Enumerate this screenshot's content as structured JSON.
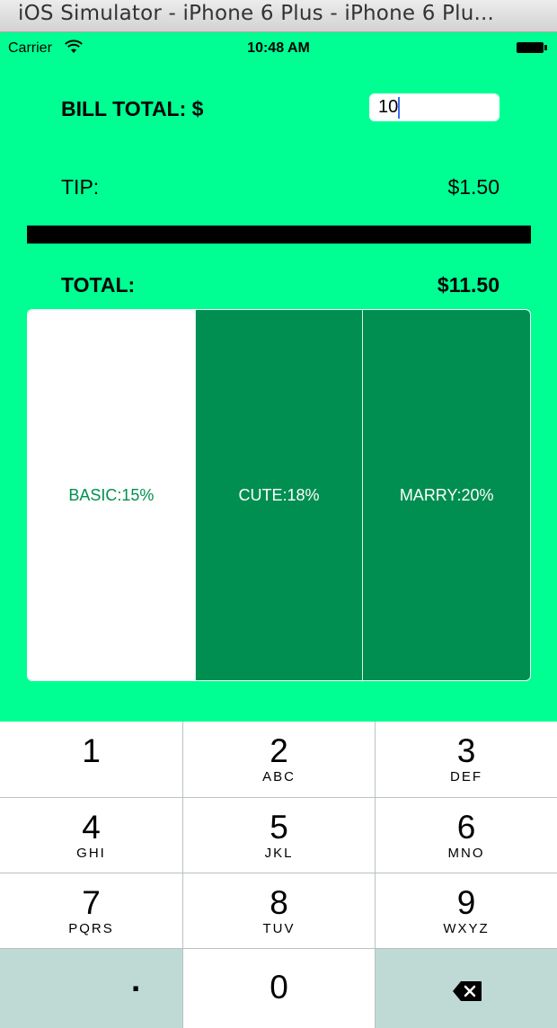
{
  "window": {
    "title": "iOS Simulator - iPhone 6 Plus - iPhone 6 Plu..."
  },
  "status_bar": {
    "carrier": "Carrier",
    "time": "10:48 AM"
  },
  "bill": {
    "label": "BILL TOTAL: $",
    "value": "10"
  },
  "tip": {
    "label": "TIP:",
    "value": "$1.50"
  },
  "total": {
    "label": "TOTAL:",
    "value": "$11.50"
  },
  "tip_options": [
    {
      "label": "BASIC:15%",
      "selected": true
    },
    {
      "label": "CUTE:18%",
      "selected": false
    },
    {
      "label": "MARRY:20%",
      "selected": false
    }
  ],
  "colors": {
    "background": "#00ff92",
    "accent": "#008f50",
    "keyboard_gray": "#bfdad4"
  },
  "keypad": {
    "keys": [
      {
        "num": "1",
        "letters": ""
      },
      {
        "num": "2",
        "letters": "ABC"
      },
      {
        "num": "3",
        "letters": "DEF"
      },
      {
        "num": "4",
        "letters": "GHI"
      },
      {
        "num": "5",
        "letters": "JKL"
      },
      {
        "num": "6",
        "letters": "MNO"
      },
      {
        "num": "7",
        "letters": "PQRS"
      },
      {
        "num": "8",
        "letters": "TUV"
      },
      {
        "num": "9",
        "letters": "WXYZ"
      }
    ],
    "dot": ".",
    "zero": "0",
    "delete_icon": "delete-backspace-icon"
  }
}
